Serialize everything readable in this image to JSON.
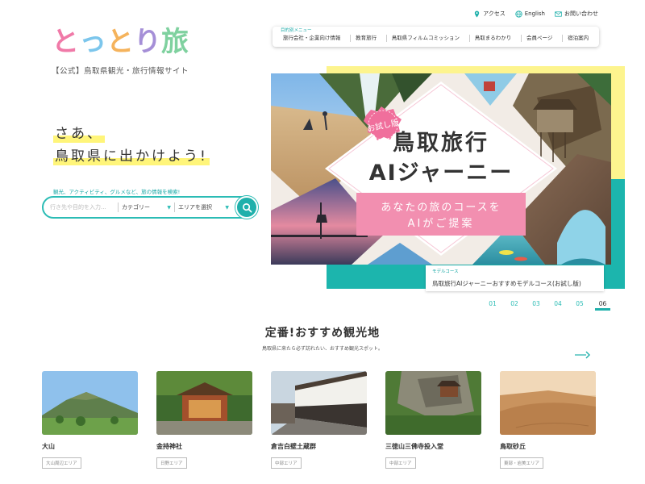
{
  "logo": {
    "chars": [
      {
        "char": "と",
        "color": "#f07aa8"
      },
      {
        "char": "っ",
        "color": "#7cc6ec"
      },
      {
        "char": "と",
        "color": "#f5b35c"
      },
      {
        "char": "り",
        "color": "#a58fd7"
      },
      {
        "char": "旅",
        "color": "#7fd19f"
      }
    ],
    "subtitle": "【公式】鳥取県観光・旅行情報サイト"
  },
  "util_nav": {
    "access": "アクセス",
    "english": "English",
    "contact": "お問い合わせ"
  },
  "main_nav": {
    "label": "目的別メニュー",
    "items": [
      "旅行会社・企業向け情報",
      "教育旅行",
      "鳥取県フィルムコミッション",
      "鳥取まるわかり",
      "会員ページ",
      "宿泊案内"
    ]
  },
  "hero": {
    "line1": "さあ、",
    "line2": "鳥取県に出かけよう!"
  },
  "search": {
    "hint": "観光、アクティビティ、グルメなど、旅の情報を検索!",
    "placeholder": "行き先や目的を入力...",
    "category": "カテゴリー",
    "area": "エリアを選択"
  },
  "banner": {
    "badge": "お試し版",
    "title_line1": "鳥取旅行",
    "title_line2": "AIジャーニー",
    "sub_line1": "あなたの旅のコースを",
    "sub_line2": "AIがご提案"
  },
  "slide_caption": {
    "tag": "モデルコース",
    "title": "鳥取旅行AIジャーニーおすすめモデルコース(お試し版)"
  },
  "pager": [
    "01",
    "02",
    "03",
    "04",
    "05",
    "06"
  ],
  "pager_active": "06",
  "spots_section": {
    "title": "定番!おすすめ観光地",
    "subtitle": "鳥取県に来たら必ず訪れたい、おすすめ観光スポット。",
    "spots": [
      {
        "name": "大山",
        "area": "大山周辺エリア"
      },
      {
        "name": "金持神社",
        "area": "日野エリア"
      },
      {
        "name": "倉吉白壁土蔵群",
        "area": "中部エリア"
      },
      {
        "name": "三徳山三佛寺投入堂",
        "area": "中部エリア"
      },
      {
        "name": "鳥取砂丘",
        "area": "東部・岩美エリア"
      }
    ]
  },
  "colors": {
    "accent_teal": "#1fb0ab",
    "highlight_yellow": "#fff57a",
    "banner_pink": "#f28fb0"
  }
}
